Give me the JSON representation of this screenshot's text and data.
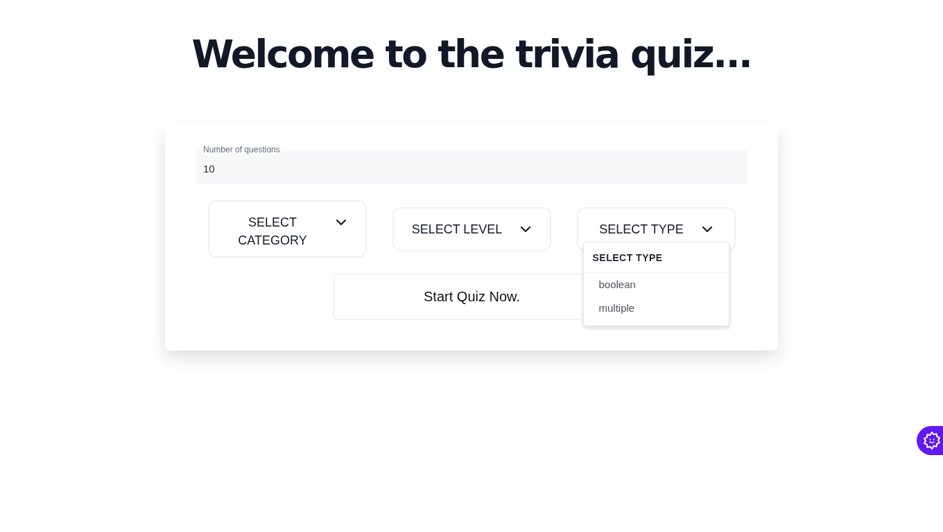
{
  "heading": "Welcome to the trivia quiz...",
  "questions_field": {
    "label": "Number of questions",
    "value": "10"
  },
  "selects": [
    {
      "label": "SELECT CATEGORY"
    },
    {
      "label": "SELECT LEVEL"
    },
    {
      "label": "SELECT TYPE",
      "menu": {
        "header": "SELECT TYPE",
        "options": [
          "boolean",
          "multiple"
        ]
      }
    }
  ],
  "start_button": "Start Quiz Now."
}
